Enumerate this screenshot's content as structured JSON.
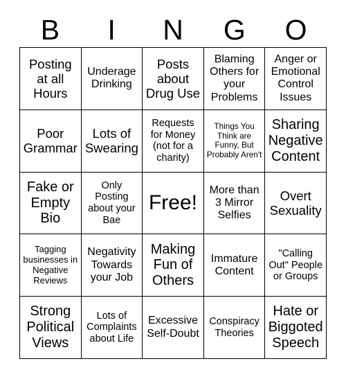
{
  "header": {
    "letters": [
      "B",
      "I",
      "N",
      "G",
      "O"
    ]
  },
  "grid": {
    "columns": 5,
    "rows": 5,
    "free_space_index": 12,
    "cells": [
      {
        "text": "Posting at all Hours",
        "size": "lg"
      },
      {
        "text": "Underage Drinking",
        "size": "md"
      },
      {
        "text": "Posts about Drug Use",
        "size": "lg"
      },
      {
        "text": "Blaming Others for your Problems",
        "size": "md"
      },
      {
        "text": "Anger or Emotional Control Issues",
        "size": "md"
      },
      {
        "text": "Poor Grammar",
        "size": "lg"
      },
      {
        "text": "Lots of Swearing",
        "size": "lg"
      },
      {
        "text": "Requests for Money (not for a charity)",
        "size": "sm"
      },
      {
        "text": "Things You Think are Funny, But Probably Aren't",
        "size": "xxs"
      },
      {
        "text": "Sharing Negative Content",
        "size": "xl"
      },
      {
        "text": "Fake or Empty Bio",
        "size": "xl"
      },
      {
        "text": "Only Posting about your Bae",
        "size": "sm"
      },
      {
        "text": "Free!",
        "size": "xxl"
      },
      {
        "text": "More than 3 Mirror Selfies",
        "size": "md"
      },
      {
        "text": "Overt Sexuality",
        "size": "lg"
      },
      {
        "text": "Tagging businesses in Negative Reviews",
        "size": "xs"
      },
      {
        "text": "Negativity Towards your Job",
        "size": "md"
      },
      {
        "text": "Making Fun of Others",
        "size": "xl"
      },
      {
        "text": "Immature Content",
        "size": "md"
      },
      {
        "text": "\"Calling Out\" People or Groups",
        "size": "sm"
      },
      {
        "text": "Strong Political Views",
        "size": "xl"
      },
      {
        "text": "Lots of Complaints about Life",
        "size": "sm"
      },
      {
        "text": "Excessive Self-Doubt",
        "size": "md"
      },
      {
        "text": "Conspiracy Theories",
        "size": "sm"
      },
      {
        "text": "Hate or Biggoted Speech",
        "size": "xl"
      }
    ]
  }
}
